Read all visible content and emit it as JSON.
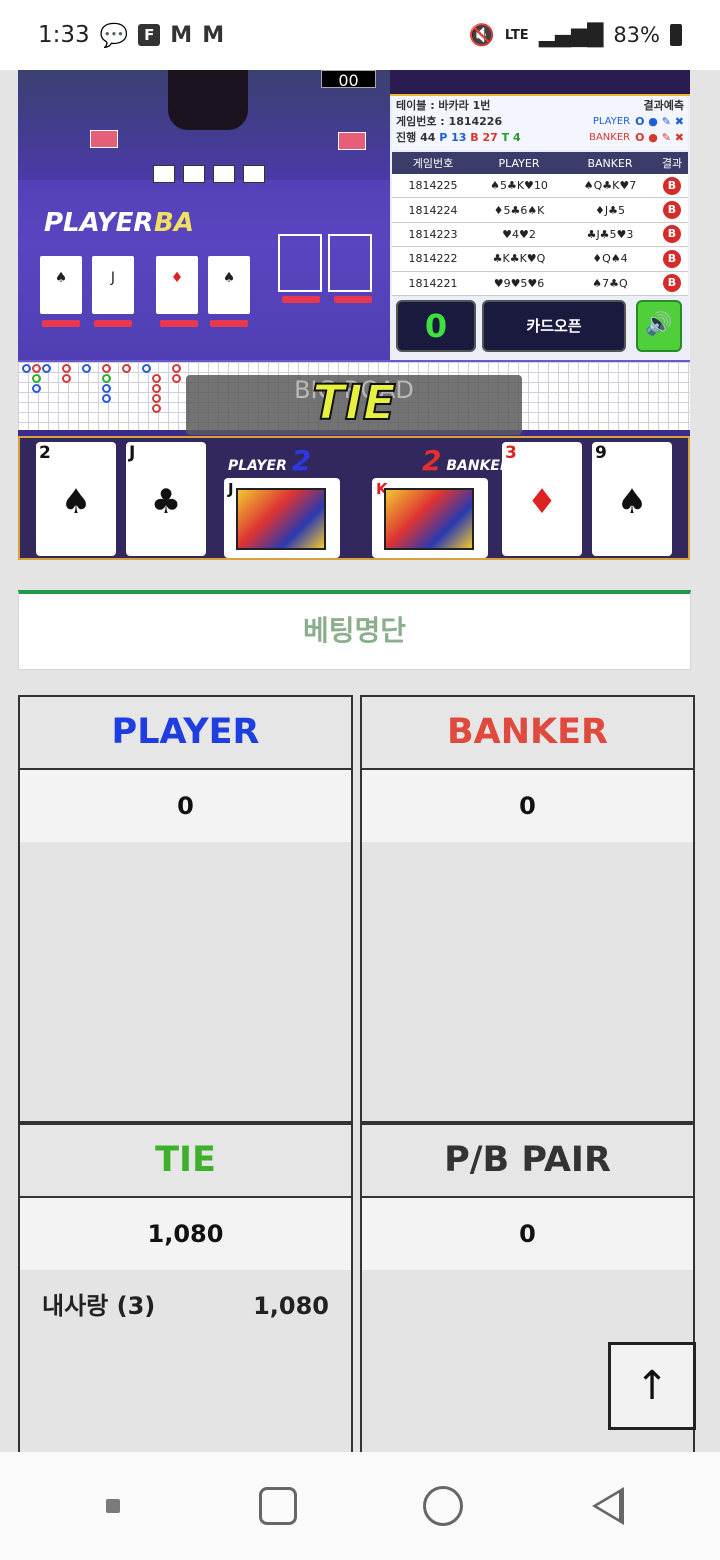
{
  "status": {
    "time": "1:33",
    "icons": [
      "chat-bubble-icon",
      "f-app-icon",
      "gmail-icon",
      "gmail-icon"
    ],
    "right_icons": [
      "mute-icon",
      "lte-icon",
      "signal-icon",
      "battery-icon"
    ],
    "lte": "LTE",
    "battery": "83%"
  },
  "game": {
    "clock": "00",
    "felt": {
      "player_label": "PLAYER",
      "banker_label": "BA"
    },
    "info": {
      "table_label": "테이블 : 바카라 1번",
      "prediction_label": "결과예측",
      "game_no_label": "게임번호 : 1814226",
      "pred_player": "PLAYER",
      "pred_banker": "BANKER",
      "pred_player_marks": "O ● ✎ ✖",
      "pred_banker_marks": "O ● ✎ ✖",
      "progress_label": "진행 44",
      "progress_p": "P 13",
      "progress_b": "B 27",
      "progress_t": "T 4"
    },
    "history": {
      "headers": [
        "게임번호",
        "PLAYER",
        "BANKER",
        "결과"
      ],
      "rows": [
        {
          "no": "1814225",
          "player": "♠5♣K♥10",
          "banker": "♠Q♣K♥7",
          "result": "B"
        },
        {
          "no": "1814224",
          "player": "♦5♣6♠K",
          "banker": "♦J♣5",
          "result": "B"
        },
        {
          "no": "1814223",
          "player": "♥4♥2",
          "banker": "♣J♣5♥3",
          "result": "B"
        },
        {
          "no": "1814222",
          "player": "♣K♣K♥Q",
          "banker": "♦Q♠4",
          "result": "B"
        },
        {
          "no": "1814221",
          "player": "♥9♥5♥6",
          "banker": "♠7♣Q",
          "result": "B"
        }
      ]
    },
    "controls": {
      "count": "0",
      "card_open": "카드오픈",
      "sound_icon": "speaker-icon"
    },
    "road": {
      "banner": "BIG ROAD",
      "result": "TIE"
    },
    "result_cards": {
      "player_tag": "PLAYER",
      "player_score": "2",
      "banker_tag": "BANKER",
      "banker_score": "2",
      "player_cards": [
        {
          "rank": "2",
          "suit": "♠"
        },
        {
          "rank": "J",
          "suit": "♣"
        },
        {
          "rank": "J",
          "suit": "♦"
        }
      ],
      "banker_cards": [
        {
          "rank": "K",
          "suit": "♥"
        },
        {
          "rank": "3",
          "suit": "♦"
        },
        {
          "rank": "9",
          "suit": "♠"
        }
      ]
    }
  },
  "bet_list_button": "베팅명단",
  "bets": {
    "player": {
      "title": "PLAYER",
      "total": "0"
    },
    "banker": {
      "title": "BANKER",
      "total": "0"
    },
    "tie": {
      "title": "TIE",
      "total": "1,080",
      "entries": [
        {
          "name": "내사랑 (3)",
          "amount": "1,080"
        }
      ]
    },
    "pair": {
      "title": "P/B PAIR",
      "total": "0"
    }
  },
  "to_top_icon": "↑",
  "colors": {
    "player": "#1e3ee0",
    "banker": "#e04a3e",
    "tie": "#3fb02a",
    "accent": "#1f9a49"
  }
}
